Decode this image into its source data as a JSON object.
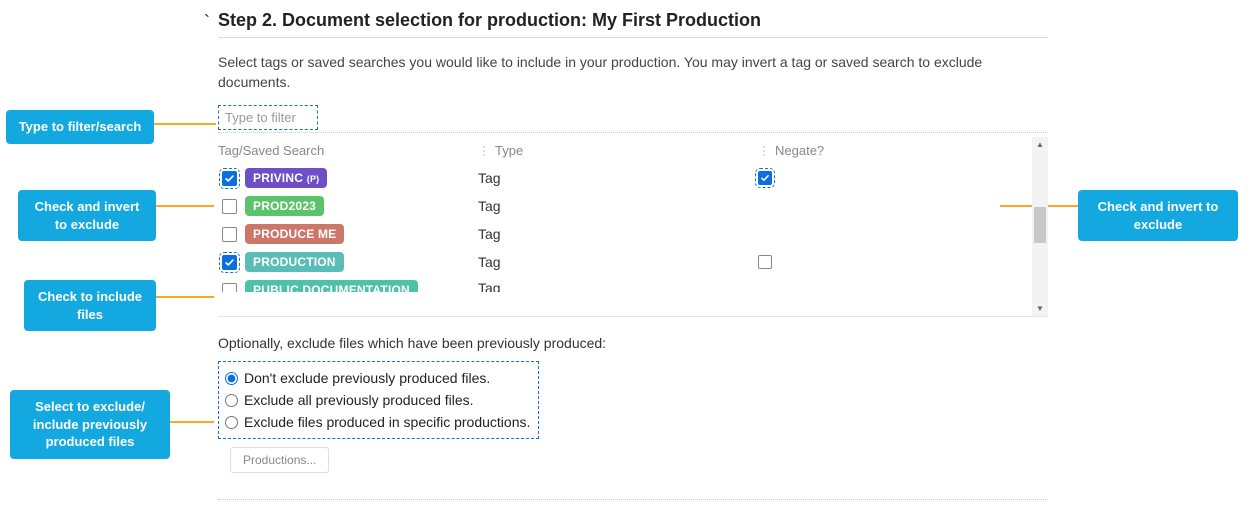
{
  "heading": "Step 2. Document selection for production: My First Production",
  "description": "Select tags or saved searches you would like to include in your production. You may invert a tag or saved search to exclude documents.",
  "filter_placeholder": "Type to filter",
  "columns": {
    "tag": "Tag/Saved Search",
    "type": "Type",
    "negate": "Negate?"
  },
  "rows": [
    {
      "label": "PRIVINC",
      "suffix": "(P)",
      "color": "#6e4fc7",
      "type": "Tag",
      "checked": true,
      "dashed": true,
      "negate_checked": true,
      "negate_dashed": true,
      "negate_visible": true
    },
    {
      "label": "PROD2023",
      "suffix": "",
      "color": "#5bc36a",
      "type": "Tag",
      "checked": false,
      "dashed": false,
      "negate_checked": false,
      "negate_dashed": false,
      "negate_visible": false
    },
    {
      "label": "PRODUCE ME",
      "suffix": "",
      "color": "#cc776a",
      "type": "Tag",
      "checked": false,
      "dashed": false,
      "negate_checked": false,
      "negate_dashed": false,
      "negate_visible": false
    },
    {
      "label": "PRODUCTION",
      "suffix": "",
      "color": "#5bbdb8",
      "type": "Tag",
      "checked": true,
      "dashed": true,
      "negate_checked": false,
      "negate_dashed": false,
      "negate_visible": true
    },
    {
      "label": "PUBLIC DOCUMENTATION",
      "suffix": "",
      "color": "#4ec2a7",
      "type": "Tag",
      "checked": false,
      "dashed": false,
      "negate_checked": false,
      "negate_dashed": false,
      "negate_visible": false
    }
  ],
  "optional_text": "Optionally, exclude files which have been previously produced:",
  "radio": {
    "options": [
      "Don't exclude previously produced files.",
      "Exclude all previously produced files.",
      "Exclude files produced in specific productions."
    ],
    "selected": 0
  },
  "productions_button": "Productions...",
  "callouts": {
    "filter": "Type to filter/search",
    "invert_left": "Check and invert to exclude",
    "invert_right": "Check and invert to exclude",
    "include": "Check to include files",
    "exclude": "Select to exclude/\ninclude previously produced files"
  }
}
